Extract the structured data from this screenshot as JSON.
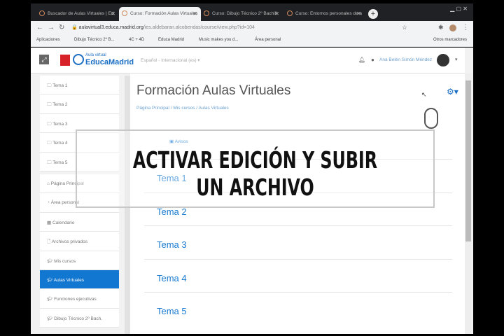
{
  "browser": {
    "tabs": [
      {
        "label": "Buscador de Aulas Virtuales | Ed",
        "active": false
      },
      {
        "label": "Curso: Formación Aulas Virtuales",
        "active": true
      },
      {
        "label": "Curso: Dibujo Técnico 2º Bachill",
        "active": false
      },
      {
        "label": "Curso: Entornos personales de a",
        "active": false
      }
    ],
    "url_domain": "aulavirtual3.educa.madrid.org",
    "url_path": "/ies.aldebaran.alcobendas/course/view.php?id=104",
    "bookmarks": [
      "Aplicaciones",
      "Dibujo Técnico 2º B...",
      "4C + 4D",
      "Educa Madrid",
      "Music makes you d...",
      "Área personal"
    ],
    "other_bookmarks": "Otros marcadores"
  },
  "header": {
    "logo_small": "Aula virtual",
    "logo_big": "EducaMadrid",
    "language": "Español - Internacional (es) ▾",
    "user": "Ana Belén Simón Méndez"
  },
  "sidebar": {
    "items": [
      {
        "label": "Tema 1",
        "icon": "folder-icon"
      },
      {
        "label": "Tema 2",
        "icon": "folder-icon"
      },
      {
        "label": "Tema 3",
        "icon": "folder-icon"
      },
      {
        "label": "Tema 4",
        "icon": "folder-icon"
      },
      {
        "label": "Tema 5",
        "icon": "folder-icon"
      },
      {
        "label": "Página Principal",
        "icon": "home-icon"
      },
      {
        "label": "Área personal",
        "icon": "dashboard-icon"
      },
      {
        "label": "Calendario",
        "icon": "calendar-icon"
      },
      {
        "label": "Archivos privados",
        "icon": "file-icon"
      },
      {
        "label": "Mis cursos",
        "icon": "graduation-cap-icon"
      },
      {
        "label": "Aulas Virtuales",
        "icon": "graduation-cap-icon",
        "active": true
      },
      {
        "label": "Funciones ejecutivas",
        "icon": "graduation-cap-icon"
      },
      {
        "label": "Dibujo Técnico 2º Bach.",
        "icon": "graduation-cap-icon"
      }
    ]
  },
  "main": {
    "title": "Formación Aulas Virtuales",
    "breadcrumb": [
      "Página Principal",
      "Mis cursos",
      "Aulas Virtuales"
    ],
    "news": "Avisos",
    "sections": [
      "Tema 1",
      "Tema 2",
      "Tema 3",
      "Tema 4",
      "Tema 5"
    ]
  },
  "overlay": {
    "text": "ACTIVAR EDICIÓN Y SUBIR UN ARCHIVO"
  },
  "colors": {
    "accent": "#1177d1",
    "link": "#1a7bd1"
  }
}
